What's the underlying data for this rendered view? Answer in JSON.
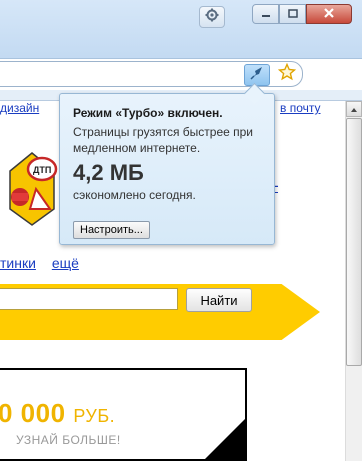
{
  "popup": {
    "title": "Режим «Турбо» включен.",
    "description": "Страницы грузятся быстрее при медленном интернете.",
    "amount": "4,2 МБ",
    "saved_text": "сэкономлено сегодня.",
    "settings_button": "Настроить..."
  },
  "page": {
    "top_link_left": "дизайн",
    "top_link_right": "в почту",
    "right_dash": "—",
    "services": [
      "тинки",
      "ещё"
    ],
    "search_button": "Найти",
    "ad_amount": "0 000",
    "ad_currency": "РУБ.",
    "ad_cta": "УЗНАЙ БОЛЬШЕ!",
    "logo_badge": "ДТП"
  },
  "colors": {
    "accent_yellow": "#ffcc00",
    "link_blue": "#1a3dc1",
    "popup_bg": "#dcebf8"
  },
  "icons": [
    "gear-icon",
    "minimize-icon",
    "maximize-icon",
    "close-icon",
    "turbo-rocket-icon",
    "bookmark-star-icon",
    "scroll-up-arrow-icon"
  ]
}
